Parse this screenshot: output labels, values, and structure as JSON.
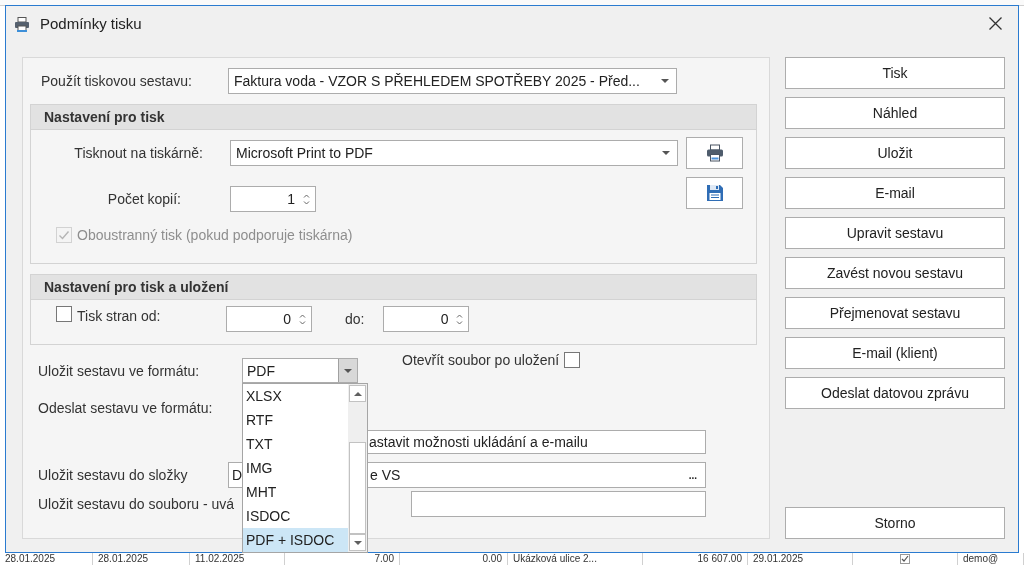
{
  "window": {
    "title": "Podmínky tisku"
  },
  "report": {
    "label": "Použít tiskovou sestavu:",
    "value": "Faktura voda - VZOR S PŘEHLEDEM SPOTŘEBY 2025 - Před..."
  },
  "print_section": {
    "title": "Nastavení pro tisk",
    "printer": {
      "label": "Tisknout na tiskárně:",
      "value": "Microsoft Print to PDF"
    },
    "copies": {
      "label": "Počet kopií:",
      "value": "1"
    },
    "duplex": {
      "label": "Oboustranný tisk (pokud podporuje tiskárna)",
      "checked": true,
      "disabled": true
    }
  },
  "print_save_section": {
    "title": "Nastavení pro tisk a uložení",
    "page_range": {
      "label": "Tisk stran od:",
      "checked": false,
      "from": "0",
      "to_label": "do:",
      "to": "0"
    }
  },
  "save_format": {
    "label": "Uložit sestavu ve formátu:",
    "value": "PDF",
    "expanded": true,
    "options": [
      {
        "label": "XLSX",
        "selected": false
      },
      {
        "label": "RTF",
        "selected": false
      },
      {
        "label": "TXT",
        "selected": false
      },
      {
        "label": "IMG",
        "selected": false
      },
      {
        "label": "MHT",
        "selected": false
      },
      {
        "label": "ISDOC",
        "selected": false
      },
      {
        "label": "PDF + ISDOC",
        "selected": true
      }
    ]
  },
  "open_after_save": {
    "label": "Otevřít soubor po uložení",
    "checked": false
  },
  "send_format": {
    "label": "Odeslat sestavu ve formátu:"
  },
  "options_field": {
    "value": "astavit možnosti ukládání a e-mailu"
  },
  "folder": {
    "label": "Uložit sestavu do složky",
    "value_parts": [
      "D",
      "e VS"
    ],
    "browse": "..."
  },
  "file": {
    "label": "Uložit sestavu do souboru - uvá"
  },
  "buttons": [
    {
      "label": "Tisk"
    },
    {
      "label": "Náhled"
    },
    {
      "label": "Uložit"
    },
    {
      "label": "E-mail"
    },
    {
      "label": "Upravit sestavu"
    },
    {
      "label": "Zavést novou sestavu"
    },
    {
      "label": "Přejmenovat sestavu"
    },
    {
      "label": "E-mail (klient)"
    },
    {
      "label": "Odeslat datovou zprávu"
    }
  ],
  "cancel_button": {
    "label": "Storno"
  },
  "background_row": {
    "cells": [
      {
        "kind": "text",
        "text": "28.01.2025"
      },
      {
        "kind": "text",
        "text": "28.01.2025"
      },
      {
        "kind": "text",
        "text": "11.02.2025"
      },
      {
        "kind": "amount",
        "text": "7.00"
      },
      {
        "kind": "amount",
        "text": "0.00"
      },
      {
        "kind": "text",
        "text": "Ukázková ulice 2..."
      },
      {
        "kind": "amount",
        "text": "16 607.00"
      },
      {
        "kind": "text",
        "text": "29.01.2025"
      },
      {
        "kind": "check",
        "checked": true
      },
      {
        "kind": "text",
        "text": "demo@"
      }
    ]
  }
}
